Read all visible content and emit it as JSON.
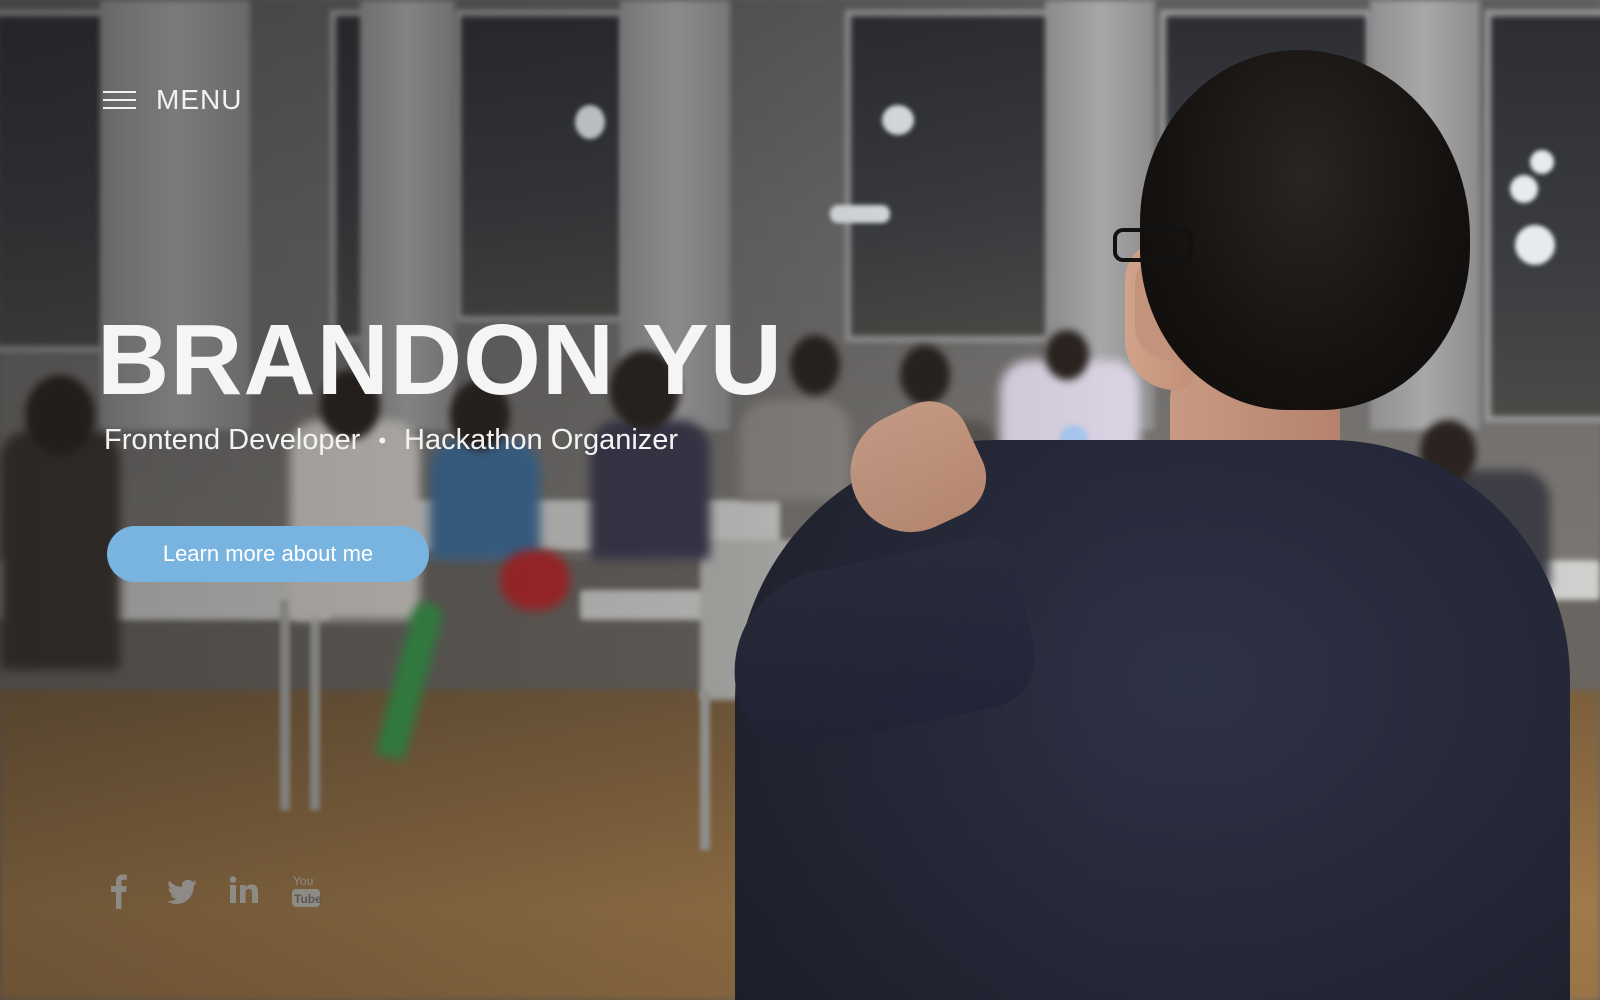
{
  "menu": {
    "label": "MENU",
    "icon": "hamburger-icon"
  },
  "hero": {
    "title": "BRANDON YU",
    "subtitle_roles": [
      "Frontend Developer",
      "Hackathon Organizer"
    ],
    "separator": "•",
    "cta_label": "Learn more about me"
  },
  "social": [
    {
      "name": "facebook",
      "icon": "facebook-icon"
    },
    {
      "name": "twitter",
      "icon": "twitter-icon"
    },
    {
      "name": "linkedin",
      "icon": "linkedin-icon"
    },
    {
      "name": "youtube",
      "icon": "youtube-icon",
      "logo_text": [
        "You",
        "Tube"
      ]
    }
  ],
  "colors": {
    "text": "#f5f5f5",
    "cta_background": "#79b4e0",
    "social_icons": "#8e8a86"
  }
}
